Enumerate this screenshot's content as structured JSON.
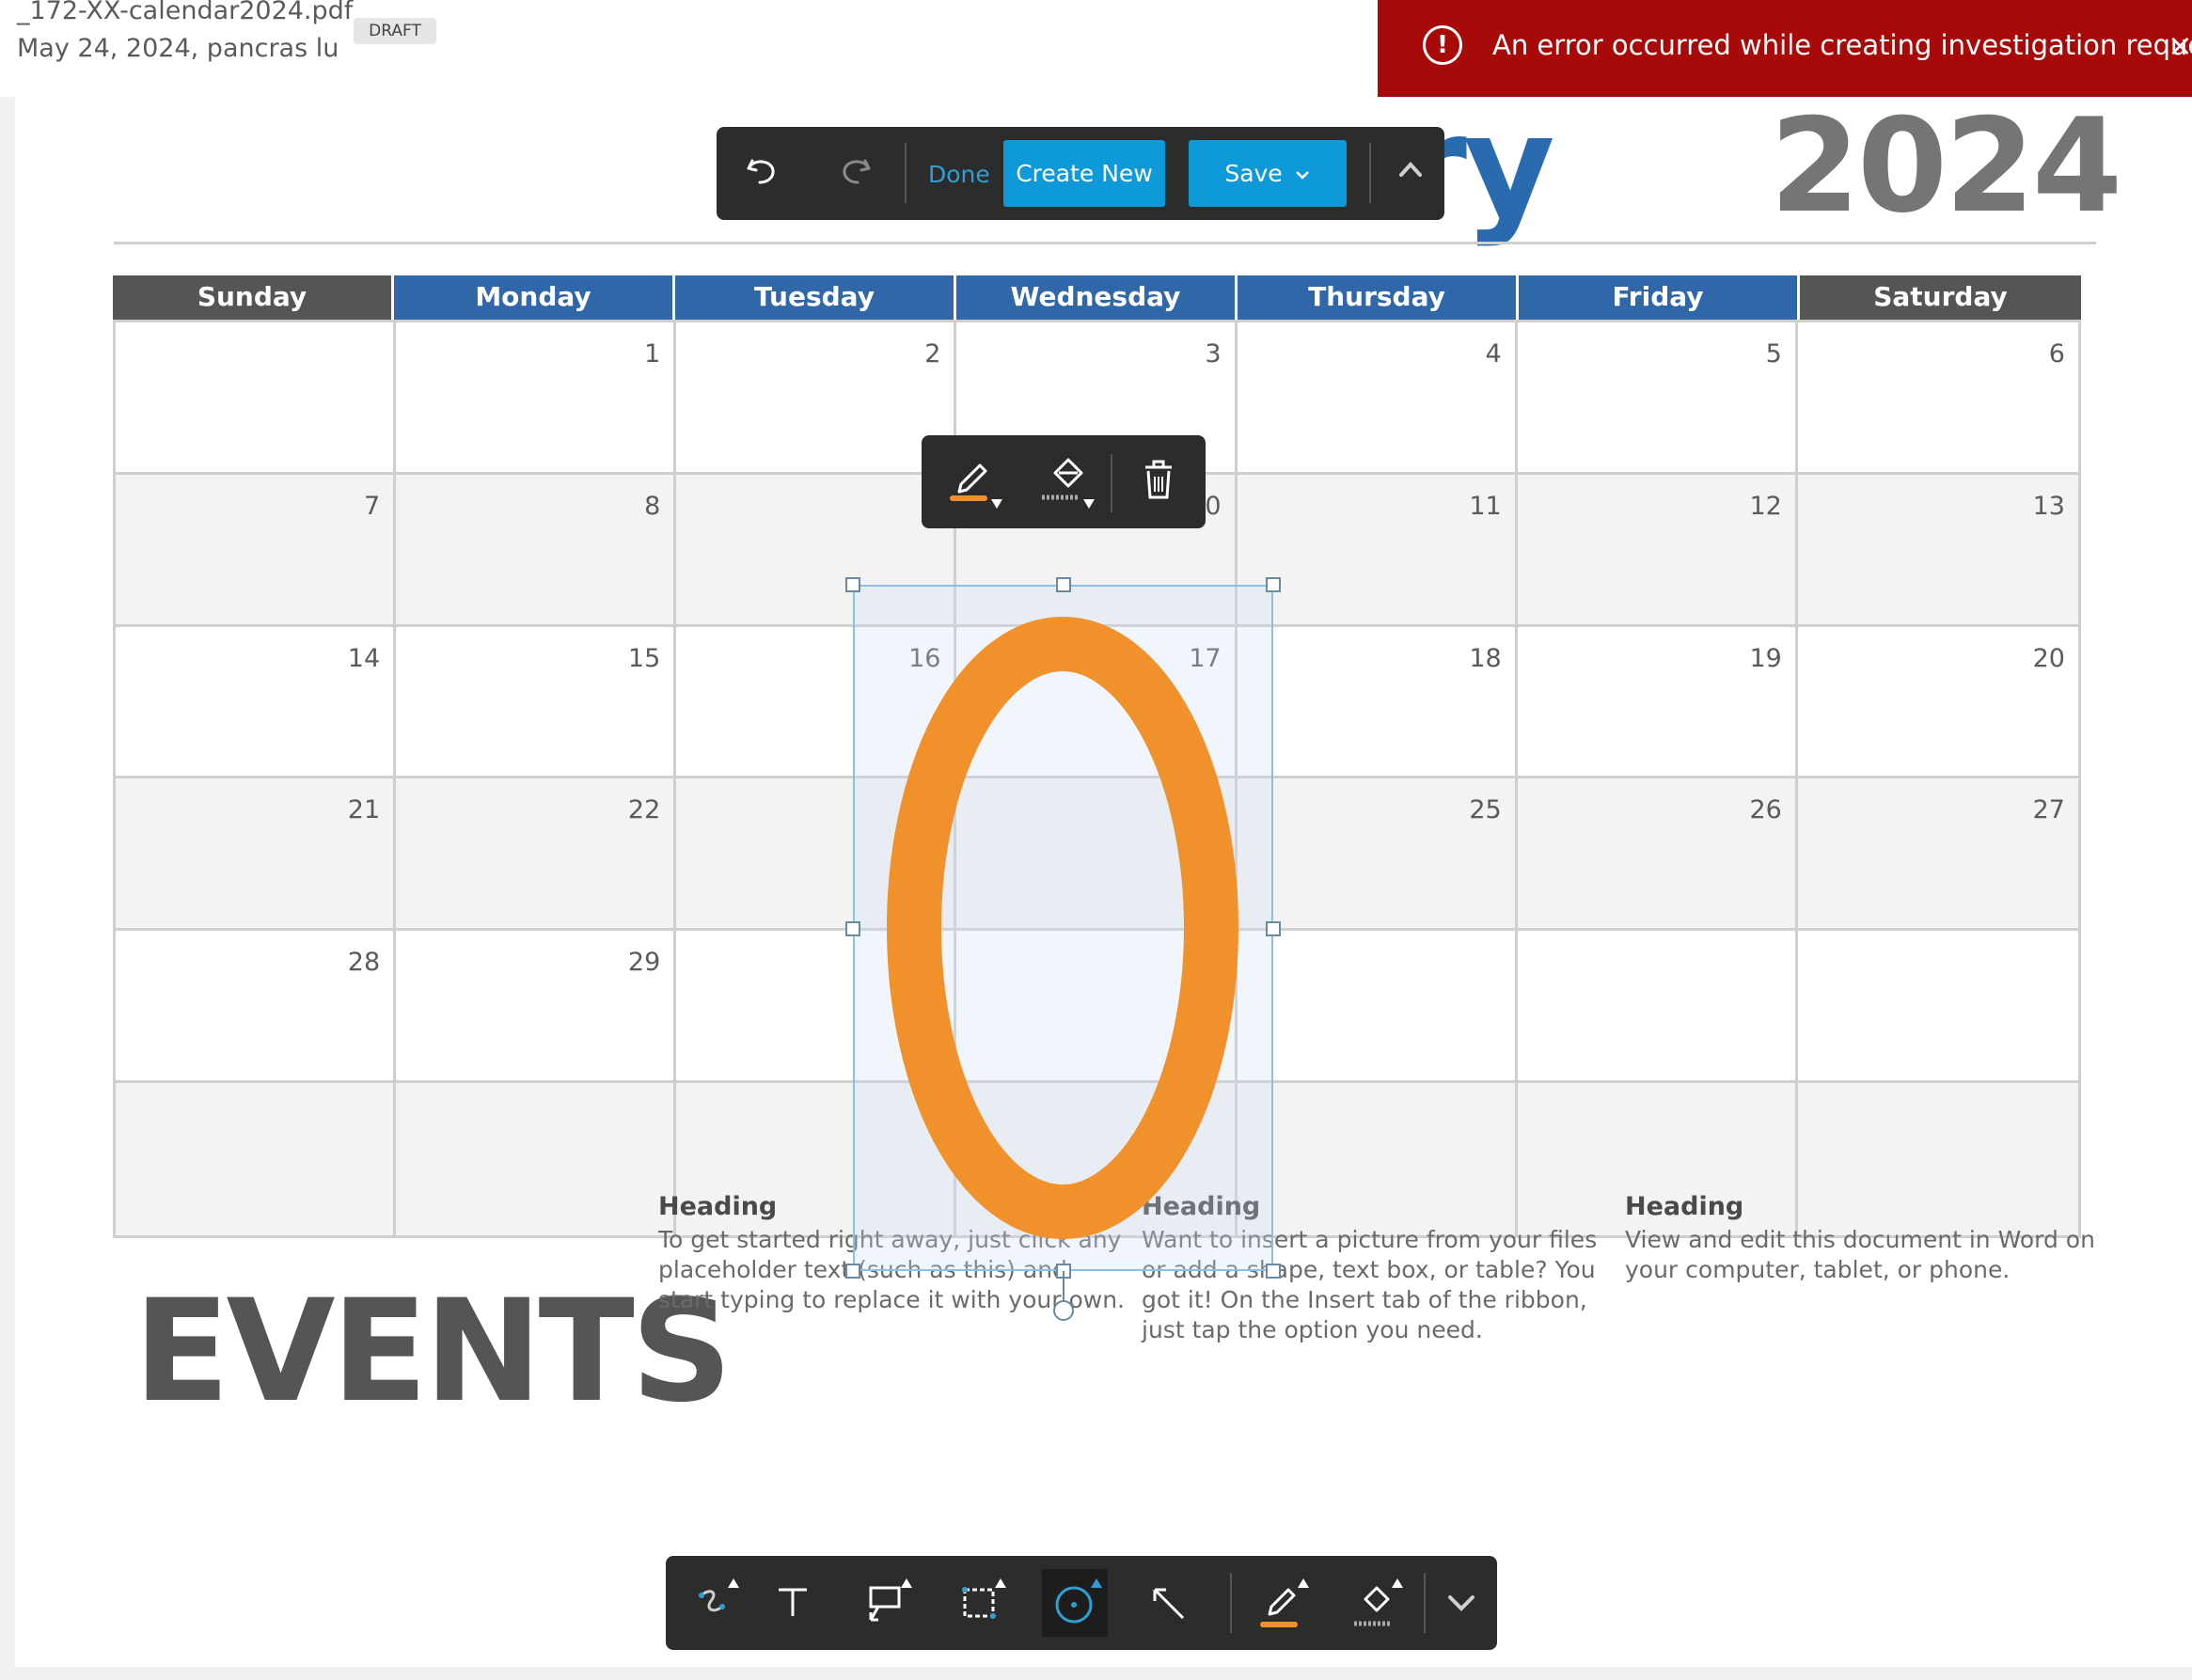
{
  "header": {
    "filename": "_172-XX-calendar2024.pdf",
    "meta": "May 24, 2024, pancras lu",
    "badge": "DRAFT"
  },
  "error_toast": {
    "icon": "!",
    "message": "An error occurred while creating investigation request.",
    "close": "×"
  },
  "calendar": {
    "month_visible": "uary",
    "year": "2024",
    "days": [
      "Sunday",
      "Monday",
      "Tuesday",
      "Wednesday",
      "Thursday",
      "Friday",
      "Saturday"
    ],
    "cells": [
      "",
      "1",
      "2",
      "3",
      "4",
      "5",
      "6",
      "7",
      "8",
      "",
      "0",
      "11",
      "12",
      "13",
      "14",
      "15",
      "16",
      "17",
      "18",
      "19",
      "20",
      "21",
      "22",
      "",
      "",
      "25",
      "26",
      "27",
      "28",
      "29",
      "",
      "",
      "",
      "",
      "",
      "",
      "",
      "",
      "",
      "",
      "",
      ""
    ]
  },
  "events": {
    "title": "EVENTS",
    "columns": [
      {
        "heading": "Heading",
        "text": "To get started right away, just click any placeholder text (such as this) and start typing to replace it with your own."
      },
      {
        "heading": "Heading",
        "text": "Want to insert a picture from your files or add a shape, text box, or table? You got it! On the Insert tab of the ribbon, just tap the option you need."
      },
      {
        "heading": "Heading",
        "text": "View and edit this document in Word on your computer, tablet, or phone."
      }
    ]
  },
  "edit_toolbar": {
    "done": "Done",
    "create_new": "Create New",
    "save": "Save"
  },
  "annotation": {
    "stroke_color": "#f0912c",
    "icons": [
      "pen-icon",
      "fill-bucket-icon",
      "trash-icon"
    ]
  },
  "bottom_toolbar": {
    "tools": [
      "freehand-draw-icon",
      "text-tool-icon",
      "callout-icon",
      "area-select-icon",
      "ellipse-tool-icon",
      "arrow-tool-icon",
      "pen-color-icon",
      "fill-color-icon",
      "chevron-down-icon"
    ],
    "active_tool": "ellipse-tool-icon"
  },
  "colors": {
    "error": "#a80a0a",
    "accent": "#0e9ad8",
    "header_blue": "#2f67a8",
    "stroke_orange": "#f0912c"
  }
}
